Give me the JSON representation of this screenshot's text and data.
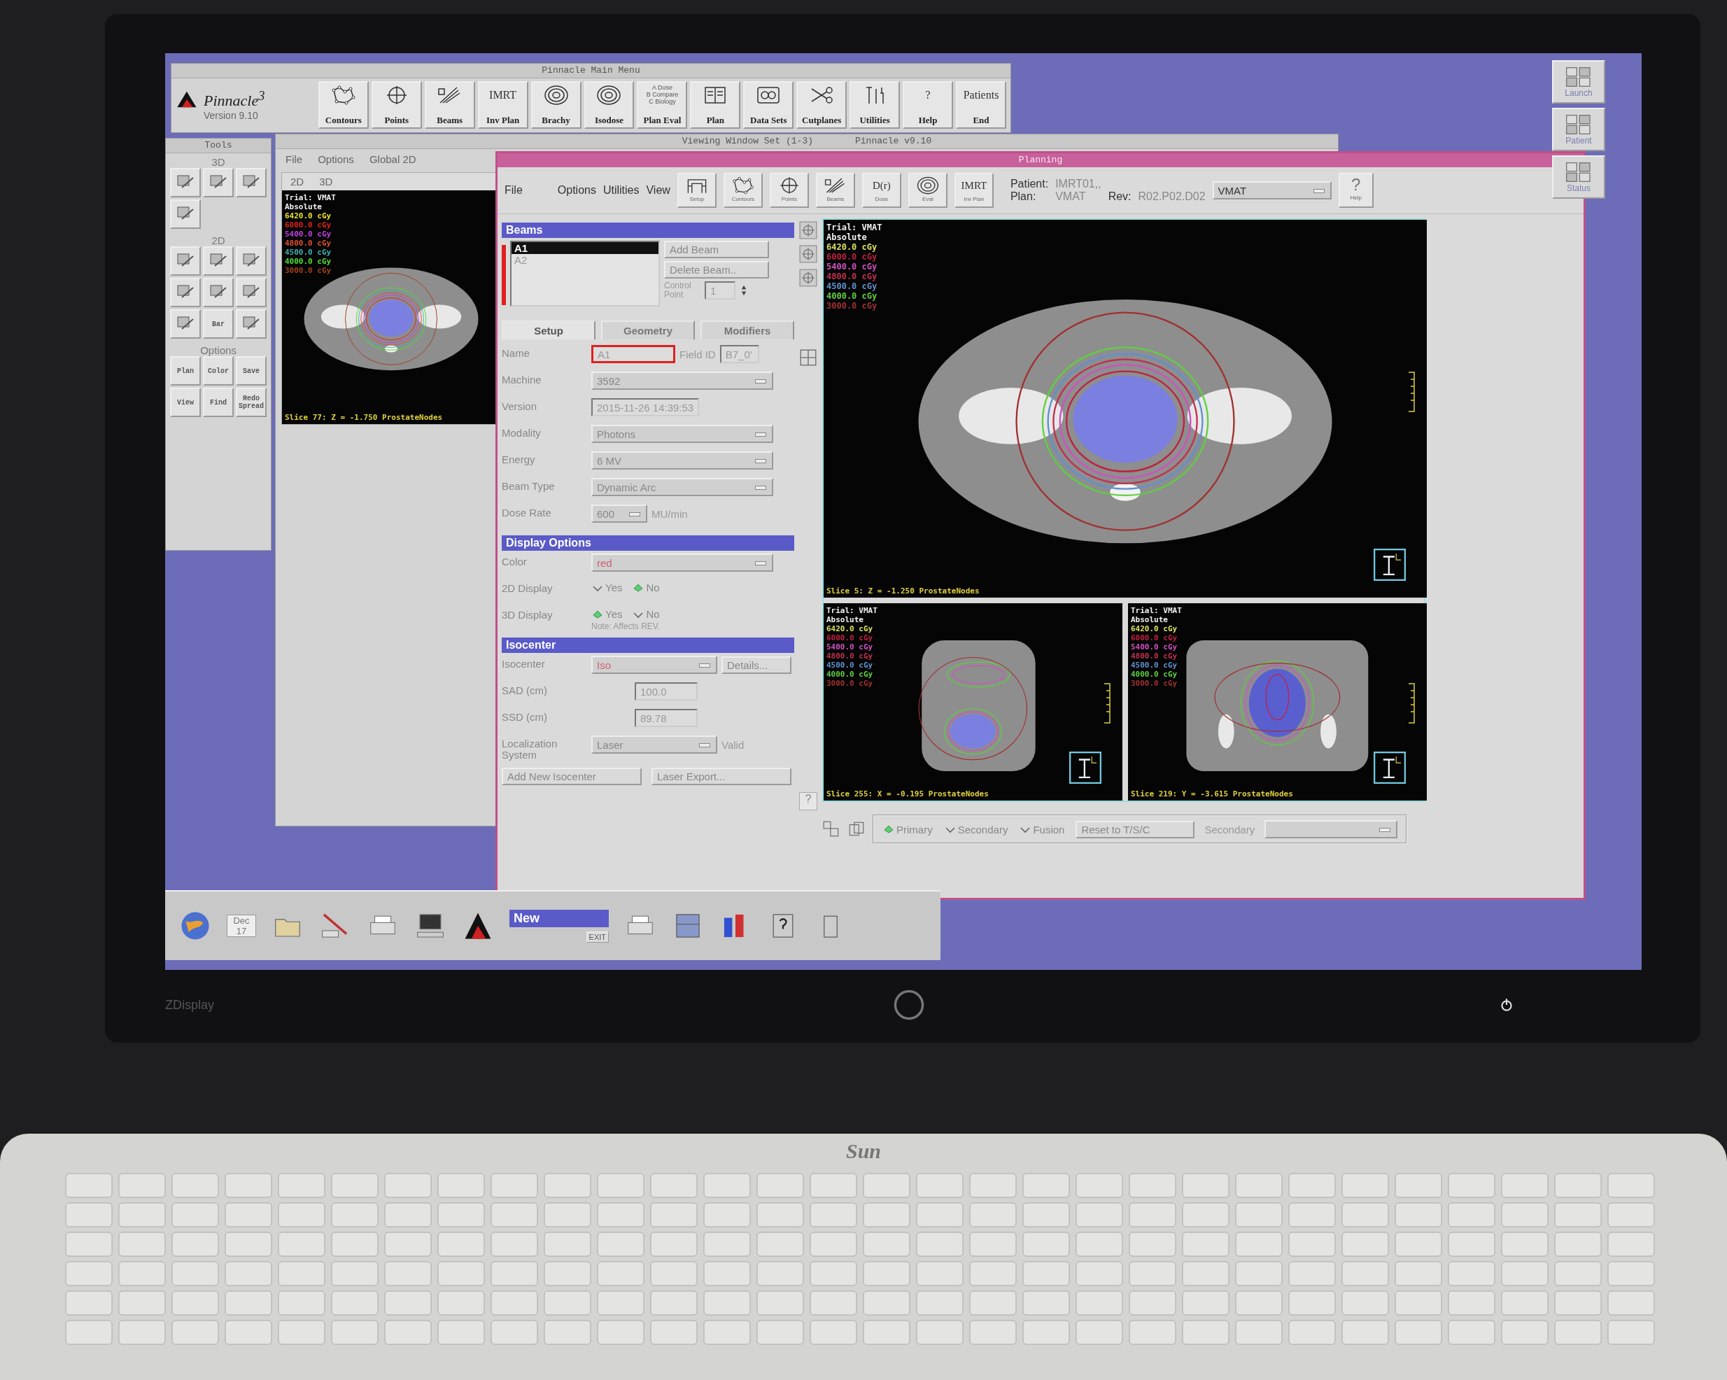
{
  "main_menu": {
    "title": "Pinnacle Main Menu",
    "logo": "Pinnacle$^{3}$",
    "version": "Version 9.10",
    "tools": [
      {
        "label": "Contours",
        "kind": "contour"
      },
      {
        "label": "Points",
        "kind": "crosshair"
      },
      {
        "label": "Beams",
        "kind": "beam"
      },
      {
        "label": "Inv Plan",
        "kind": "text",
        "icon_text": "IMRT"
      },
      {
        "label": "Brachy",
        "kind": "rings"
      },
      {
        "label": "Isodose",
        "kind": "rings"
      },
      {
        "label": "Plan Eval",
        "kind": "lines",
        "icon_lines": [
          "A Dose",
          "B Compare",
          "C Biology"
        ]
      },
      {
        "label": "Plan",
        "kind": "document"
      },
      {
        "label": "Data Sets",
        "kind": "disk"
      },
      {
        "label": "Cutplanes",
        "kind": "scissors"
      },
      {
        "label": "Utilities",
        "kind": "tools"
      },
      {
        "label": "Help",
        "kind": "text",
        "icon_text": "?"
      },
      {
        "label": "End",
        "kind": "text",
        "icon_text": "Patients"
      }
    ]
  },
  "tools_window": {
    "title": "Tools",
    "sections": [
      {
        "title": "3D",
        "buttons": [
          {
            "kind": "icon"
          },
          {
            "kind": "icon"
          },
          {
            "kind": "icon"
          },
          {
            "kind": "icon"
          }
        ]
      },
      {
        "title": "2D",
        "buttons": [
          {
            "kind": "icon"
          },
          {
            "kind": "icon"
          },
          {
            "kind": "icon"
          },
          {
            "kind": "icon"
          },
          {
            "kind": "icon"
          },
          {
            "kind": "icon"
          },
          {
            "kind": "icon"
          },
          {
            "kind": "labelled",
            "label": "Bar"
          },
          {
            "kind": "icon"
          }
        ]
      },
      {
        "title": "Options",
        "buttons": [
          {
            "kind": "labelled",
            "label": "Plan"
          },
          {
            "kind": "labelled",
            "label": "Color"
          },
          {
            "kind": "labelled",
            "label": "Save"
          },
          {
            "kind": "labelled",
            "label": "View"
          },
          {
            "kind": "labelled",
            "label": "Find"
          },
          {
            "kind": "labelled",
            "label": "Redo Spread"
          }
        ]
      }
    ]
  },
  "viewing_window": {
    "title": "Viewing Window Set (1-3)",
    "subtitle": "Pinnacle v9.10",
    "menu": [
      "File",
      "Options",
      "Global 2D"
    ],
    "tabs": [
      "2D",
      "3D"
    ],
    "viewer": {
      "kind": "axial",
      "trial": "Trial: VMAT",
      "mode": "Absolute",
      "slice": "Slice 77: Z = -1.750 ProstateNodes",
      "legend": [
        {
          "text": "6420.0 cGy",
          "color": "#e8e030"
        },
        {
          "text": "6000.0 cGy",
          "color": "#e02020"
        },
        {
          "text": "5400.0 cGy",
          "color": "#c040e0"
        },
        {
          "text": "4800.0 cGy",
          "color": "#e05030"
        },
        {
          "text": "4500.0 cGy",
          "color": "#40b0b0"
        },
        {
          "text": "4000.0 cGy",
          "color": "#50e030"
        },
        {
          "text": "3000.0 cGy",
          "color": "#a04020"
        }
      ]
    }
  },
  "planning": {
    "title": "Planning",
    "menu": [
      "File",
      "Options",
      "Utilities",
      "View"
    ],
    "toolbar": [
      {
        "label": "Setup",
        "kind": "setup"
      },
      {
        "label": "Contours",
        "kind": "contour"
      },
      {
        "label": "Points",
        "kind": "crosshair"
      },
      {
        "label": "Beams",
        "kind": "beam"
      },
      {
        "label": "Dose",
        "kind": "text",
        "icon_text": "D(r)"
      },
      {
        "label": "Eval",
        "kind": "rings"
      },
      {
        "label": "Inv Plan",
        "kind": "text",
        "icon_text": "IMRT"
      }
    ],
    "patient_label": "Patient:",
    "patient": "IMRT01,,",
    "plan_label": "Plan:",
    "plan": "VMAT",
    "rev_label": "Rev:",
    "rev": "R02.P02.D02",
    "trial_select": "VMAT",
    "help": {
      "icon_text": "?",
      "label": "Help"
    },
    "beams": {
      "title": "Beams",
      "list": [
        {
          "name": "A1",
          "selected": true
        },
        {
          "name": "A2",
          "selected": false
        }
      ],
      "buttons": [
        "Add Beam",
        "Delete Beam.."
      ],
      "control_point_label": "Control Point",
      "control_point": "1"
    },
    "tabs": [
      {
        "label": "Setup",
        "selected": true
      },
      {
        "label": "Geometry",
        "selected": false
      },
      {
        "label": "Modifiers",
        "selected": false
      }
    ],
    "setup_rows": [
      {
        "label": "Name",
        "kind": "input",
        "value": "A1",
        "highlighted": true,
        "extra_label": "Field ID",
        "extra_value": "B7_0'"
      },
      {
        "label": "Machine",
        "kind": "dropdown",
        "value": "3592"
      },
      {
        "label": "Version",
        "kind": "readonly",
        "value": "2015-11-26 14:39:53"
      },
      {
        "label": "Modality",
        "kind": "dropdown",
        "value": "Photons"
      },
      {
        "label": "Energy",
        "kind": "dropdown",
        "value": "6 MV"
      },
      {
        "label": "Beam Type",
        "kind": "dropdown",
        "value": "Dynamic Arc"
      },
      {
        "label": "Dose Rate",
        "kind": "dropdown",
        "value": "600",
        "unit": "MU/min"
      }
    ],
    "display_title": "Display Options",
    "display_rows": [
      {
        "label": "Color",
        "kind": "dropdown",
        "value": "red",
        "tinted": true
      },
      {
        "label": "2D Display",
        "kind": "radio",
        "options": [
          {
            "label": "Yes",
            "selected": false
          },
          {
            "label": "No",
            "selected": true
          }
        ]
      },
      {
        "label": "3D Display",
        "kind": "radio",
        "options": [
          {
            "label": "Yes",
            "selected": true
          },
          {
            "label": "No",
            "selected": false
          }
        ],
        "note": "Note: Affects REV."
      }
    ],
    "isocenter_title": "Isocenter",
    "isocenter_rows": [
      {
        "label": "Isocenter",
        "kind": "dropdown",
        "value": "Iso",
        "tinted": true,
        "button": "Details..."
      },
      {
        "label": "SAD (cm)",
        "kind": "readonly",
        "value": "100.0"
      },
      {
        "label": "SSD (cm)",
        "kind": "readonly",
        "value": "89.78"
      },
      {
        "label": "Localization System",
        "kind": "dropdown",
        "value": "Laser",
        "status": "Valid"
      }
    ],
    "isocenter_buttons": [
      "Add New Isocenter",
      "Laser Export..."
    ],
    "help_icon_text": "?",
    "viewers": [
      {
        "kind": "axial",
        "trial": "Trial: VMAT",
        "mode": "Absolute",
        "slice": "Slice 5: Z = -1.250 ProstateNodes",
        "legend": [
          {
            "text": "6420.0 cGy",
            "color": "#d8e060"
          },
          {
            "text": "6000.0 cGy",
            "color": "#c02040"
          },
          {
            "text": "5400.0 cGy",
            "color": "#d050c0"
          },
          {
            "text": "4800.0 cGy",
            "color": "#c03050"
          },
          {
            "text": "4500.0 cGy",
            "color": "#6090d0"
          },
          {
            "text": "4000.0 cGy",
            "color": "#60d040"
          },
          {
            "text": "3000.0 cGy",
            "color": "#a03030"
          }
        ]
      },
      {
        "kind": "sagittal",
        "trial": "Trial: VMAT",
        "mode": "Absolute",
        "slice": "Slice 255: X = -0.195 ProstateNodes",
        "legend": [
          {
            "text": "6420.0 cGy",
            "color": "#d8e060"
          },
          {
            "text": "6000.0 cGy",
            "color": "#c02040"
          },
          {
            "text": "5400.0 cGy",
            "color": "#d050c0"
          },
          {
            "text": "4800.0 cGy",
            "color": "#c03050"
          },
          {
            "text": "4500.0 cGy",
            "color": "#6090d0"
          },
          {
            "text": "4000.0 cGy",
            "color": "#60d040"
          },
          {
            "text": "3000.0 cGy",
            "color": "#a03030"
          }
        ]
      },
      {
        "kind": "coronal",
        "trial": "Trial: VMAT",
        "mode": "Absolute",
        "slice": "Slice 219: Y = -3.615 ProstateNodes",
        "legend": [
          {
            "text": "6420.0 cGy",
            "color": "#d8e060"
          },
          {
            "text": "6000.0 cGy",
            "color": "#c02040"
          },
          {
            "text": "5400.0 cGy",
            "color": "#d050c0"
          },
          {
            "text": "4800.0 cGy",
            "color": "#c03050"
          },
          {
            "text": "4500.0 cGy",
            "color": "#6090d0"
          },
          {
            "text": "4000.0 cGy",
            "color": "#60d040"
          },
          {
            "text": "3000.0 cGy",
            "color": "#a03030"
          }
        ]
      }
    ],
    "image_set_options": [
      {
        "label": "Primary",
        "selected": true
      },
      {
        "label": "Secondary",
        "selected": false
      },
      {
        "label": "Fusion",
        "selected": false
      }
    ],
    "reset_button": "Reset to T/S/C",
    "secondary_label": "Secondary"
  },
  "side_panel": [
    "Launch",
    "Patient",
    "Status"
  ],
  "taskbar": {
    "month": "Dec",
    "day": "17",
    "workspace": "New",
    "exit": "EXIT"
  },
  "monitor": {
    "model": "ZDisplay"
  },
  "keyboard": {
    "brand": "Sun"
  }
}
